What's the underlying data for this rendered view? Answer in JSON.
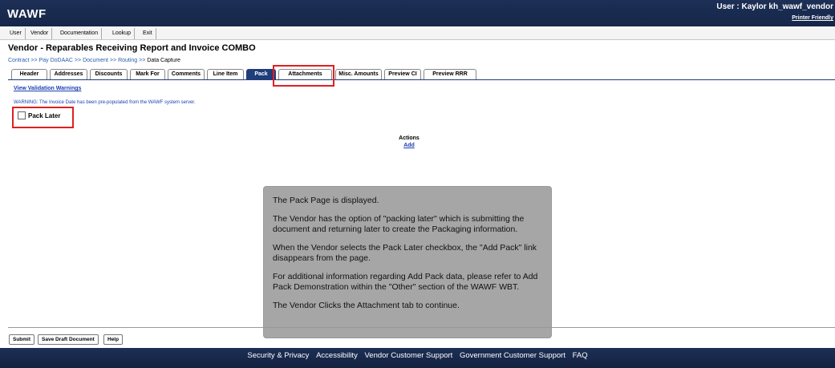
{
  "header": {
    "logo": "WAWF",
    "user": "User : Kaylor kh_wawf_vendor",
    "printer_friendly": "Printer Friendly"
  },
  "menu": [
    "User",
    "Vendor",
    "Documentation",
    "Lookup",
    "Exit"
  ],
  "page_title": "Vendor - Reparables Receiving Report and Invoice COMBO",
  "breadcrumb": {
    "items": [
      "Contract",
      "Pay DoDAAC",
      "Document",
      "Routing"
    ],
    "separator": ">>",
    "current": "Data Capture"
  },
  "tabs": [
    "Header",
    "Addresses",
    "Discounts",
    "Mark For",
    "Comments",
    "Line Item",
    "Pack",
    "Attachments",
    "Misc. Amounts",
    "Preview CI",
    "Preview RRR"
  ],
  "active_tab": "Pack",
  "validation_link": "View Validation Warnings",
  "warning": "WARNING: The Invoice Date has been pre-populated from the WAWF system server.",
  "pack_later": {
    "label": "Pack Later",
    "checked": false
  },
  "actions": {
    "heading": "Actions",
    "add": "Add"
  },
  "callout": [
    "The Pack Page is displayed.",
    "The Vendor has the option of \"packing later\" which is submitting the document and returning later to create the Packaging information.",
    "When the Vendor selects the Pack Later checkbox, the \"Add Pack\" link disappears from the page.",
    "For additional information regarding Add Pack data, please refer to Add Pack Demonstration within the \"Other\" section of the WAWF WBT.",
    "The Vendor Clicks the Attachment tab to continue."
  ],
  "buttons": {
    "submit": "Submit",
    "save_draft": "Save Draft Document",
    "help": "Help"
  },
  "footer": [
    "Security & Privacy",
    "Accessibility",
    "Vendor Customer Support",
    "Government Customer Support",
    "FAQ"
  ],
  "colors": {
    "header_bg": "#1d2f56",
    "active_tab": "#1f3d7a",
    "highlight": "#e02020",
    "callout_bg": "#a6a6a6"
  }
}
